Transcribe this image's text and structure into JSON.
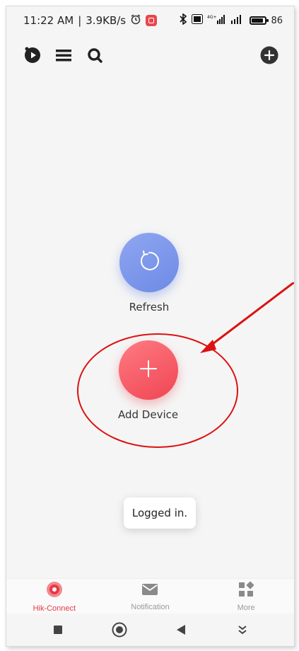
{
  "status_bar": {
    "time": "11:22 AM",
    "speed": "3.9KB/s",
    "battery": "86",
    "icons": [
      "alarm-icon",
      "app-notification-icon",
      "bluetooth-icon",
      "volte-icon",
      "signal-4g-icon",
      "signal-icon",
      "battery-icon"
    ]
  },
  "toolbar": {
    "left_icons": [
      "play-icon",
      "list-icon",
      "search-icon"
    ],
    "right_icon": "add-circle-icon"
  },
  "main": {
    "refresh_label": "Refresh",
    "add_device_label": "Add Device"
  },
  "toast": {
    "text": "Logged in."
  },
  "tabbar": {
    "tabs": [
      {
        "label": "Hik-Connect",
        "icon": "hik-connect-icon",
        "active": true
      },
      {
        "label": "Notification",
        "icon": "envelope-icon",
        "active": false
      },
      {
        "label": "More",
        "icon": "grid-icon",
        "active": false
      }
    ]
  },
  "navbar": {
    "buttons": [
      "recents-icon",
      "home-icon",
      "back-icon",
      "menu-down-icon"
    ]
  },
  "colors": {
    "accent_red": "#e63a44",
    "refresh_blue": "#7a95eb",
    "annotation_red": "#dd1111"
  }
}
